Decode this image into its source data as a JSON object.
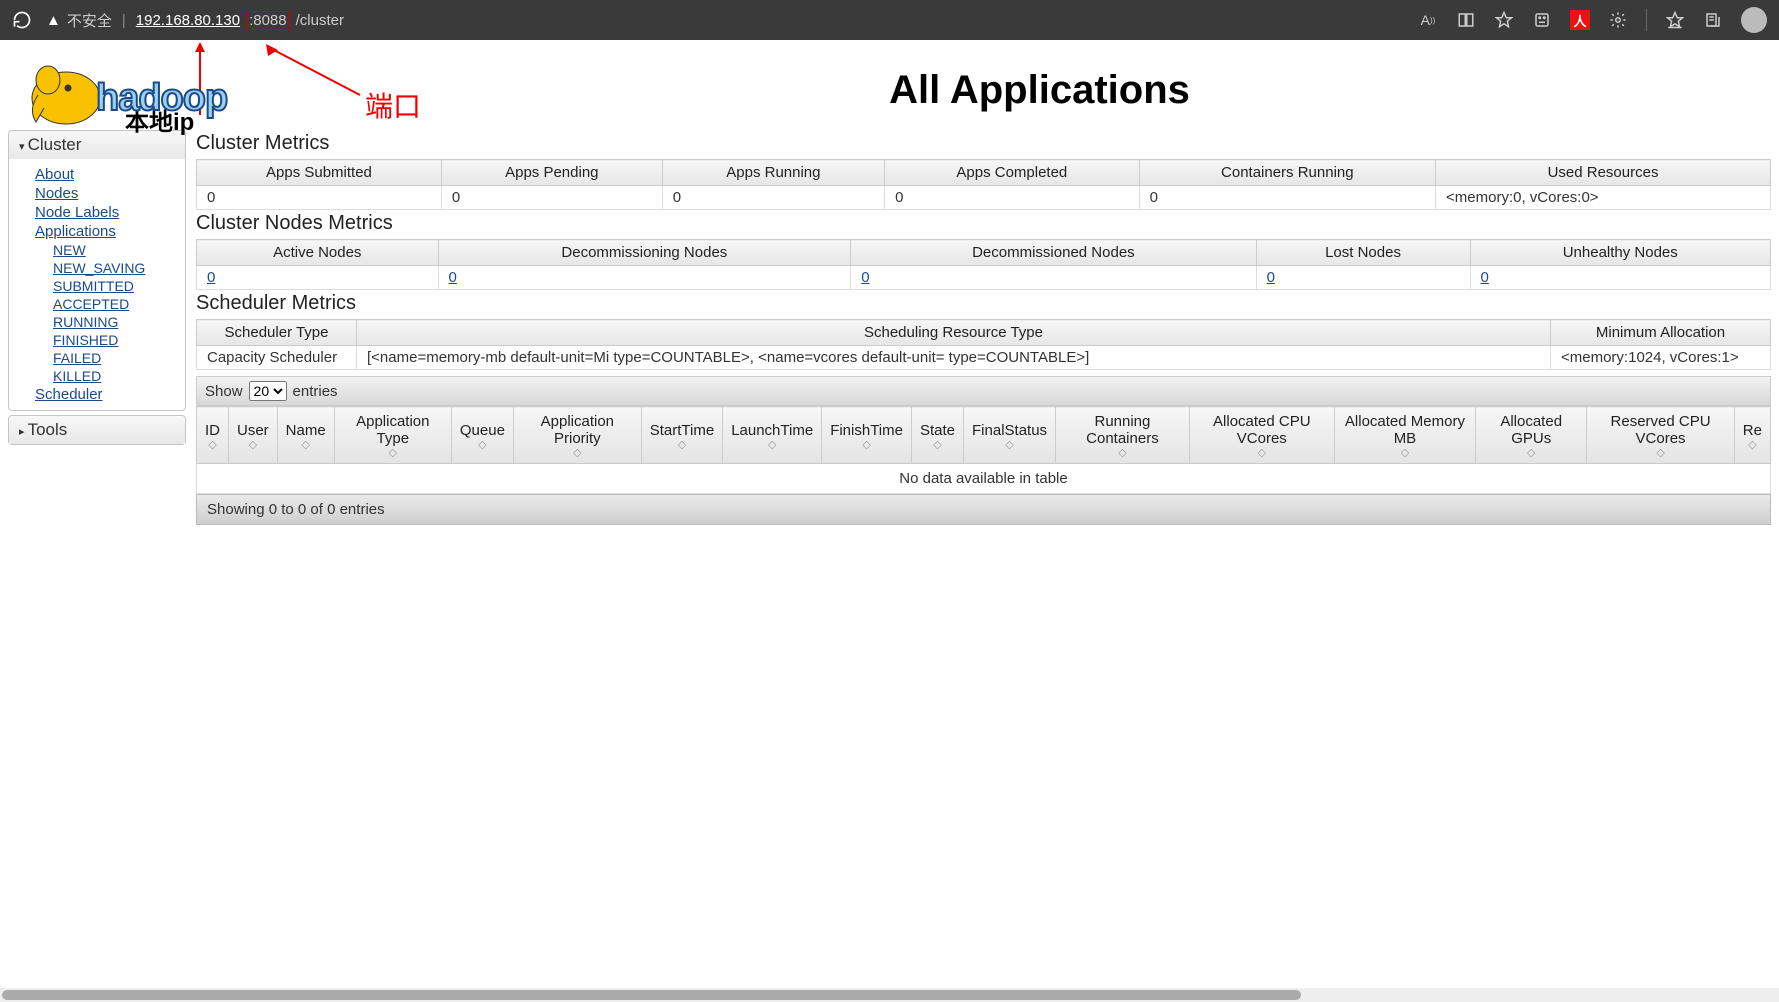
{
  "browser": {
    "insecure_label": "不安全",
    "url_ip": "192.168.80.130",
    "url_port": ":8088",
    "url_path": "/cluster"
  },
  "annotations": {
    "port_label": "端口",
    "local_ip_label": "本地ip"
  },
  "header": {
    "logo_text": "hadoop",
    "title": "All Applications"
  },
  "sidebar": {
    "cluster_label": "Cluster",
    "tools_label": "Tools",
    "links": {
      "about": "About",
      "nodes": "Nodes",
      "node_labels": "Node Labels",
      "applications": "Applications",
      "new": "NEW",
      "new_saving": "NEW_SAVING",
      "submitted": "SUBMITTED",
      "accepted": "ACCEPTED",
      "running": "RUNNING",
      "finished": "FINISHED",
      "failed": "FAILED",
      "killed": "KILLED",
      "scheduler": "Scheduler"
    }
  },
  "cluster_metrics": {
    "heading": "Cluster Metrics",
    "headers": [
      "Apps Submitted",
      "Apps Pending",
      "Apps Running",
      "Apps Completed",
      "Containers Running",
      "Used Resources"
    ],
    "row": [
      "0",
      "0",
      "0",
      "0",
      "0",
      "<memory:0, vCores:0>"
    ]
  },
  "nodes_metrics": {
    "heading": "Cluster Nodes Metrics",
    "headers": [
      "Active Nodes",
      "Decommissioning Nodes",
      "Decommissioned Nodes",
      "Lost Nodes",
      "Unhealthy Nodes"
    ],
    "row": [
      "0",
      "0",
      "0",
      "0",
      "0"
    ]
  },
  "scheduler_metrics": {
    "heading": "Scheduler Metrics",
    "headers": [
      "Scheduler Type",
      "Scheduling Resource Type",
      "Minimum Allocation"
    ],
    "row": [
      "Capacity Scheduler",
      "[<name=memory-mb default-unit=Mi type=COUNTABLE>, <name=vcores default-unit= type=COUNTABLE>]",
      "<memory:1024, vCores:1>"
    ]
  },
  "datatable": {
    "show_label": "Show",
    "entries_label": "entries",
    "page_size": "20",
    "columns": [
      "ID",
      "User",
      "Name",
      "Application Type",
      "Queue",
      "Application Priority",
      "StartTime",
      "LaunchTime",
      "FinishTime",
      "State",
      "FinalStatus",
      "Running Containers",
      "Allocated CPU VCores",
      "Allocated Memory MB",
      "Allocated GPUs",
      "Reserved CPU VCores",
      "Re"
    ],
    "empty_text": "No data available in table",
    "footer_info": "Showing 0 to 0 of 0 entries"
  }
}
